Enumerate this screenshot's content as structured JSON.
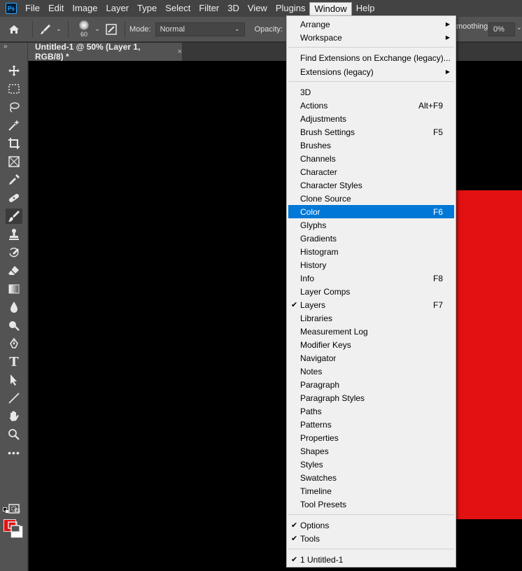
{
  "app": {
    "logo_text": "Ps"
  },
  "menubar": {
    "items": [
      "File",
      "Edit",
      "Image",
      "Layer",
      "Type",
      "Select",
      "Filter",
      "3D",
      "View",
      "Plugins",
      "Window",
      "Help"
    ],
    "active": "Window"
  },
  "options": {
    "brush_size": "60",
    "mode_label": "Mode:",
    "mode_value": "Normal",
    "opacity_label": "Opacity:",
    "smoothing_label": "moothing:",
    "smoothing_value": "0%"
  },
  "document_tab": {
    "title": "Untitled-1 @ 50% (Layer 1, RGB/8) *",
    "close": "×"
  },
  "toolbar": {
    "collapse": "»",
    "tools": [
      "move-tool",
      "marquee-tool",
      "lasso-tool",
      "magic-wand-tool",
      "crop-tool",
      "frame-tool",
      "eyedropper-tool",
      "healing-brush-tool",
      "brush-tool",
      "clone-stamp-tool",
      "history-brush-tool",
      "eraser-tool",
      "gradient-tool",
      "blur-tool",
      "dodge-tool",
      "pen-tool",
      "type-tool",
      "path-selection-tool",
      "line-tool",
      "hand-tool",
      "zoom-tool",
      "more-tools"
    ],
    "active_tool": "brush-tool",
    "foreground": "#e31111",
    "background": "#ffffff"
  },
  "window_menu": {
    "arrange": "Arrange",
    "workspace": "Workspace",
    "find_extensions": "Find Extensions on Exchange (legacy)...",
    "extensions": "Extensions (legacy)",
    "panels": [
      {
        "label": "3D",
        "shortcut": "",
        "checked": false
      },
      {
        "label": "Actions",
        "shortcut": "Alt+F9",
        "checked": false
      },
      {
        "label": "Adjustments",
        "shortcut": "",
        "checked": false
      },
      {
        "label": "Brush Settings",
        "shortcut": "F5",
        "checked": false
      },
      {
        "label": "Brushes",
        "shortcut": "",
        "checked": false
      },
      {
        "label": "Channels",
        "shortcut": "",
        "checked": false
      },
      {
        "label": "Character",
        "shortcut": "",
        "checked": false
      },
      {
        "label": "Character Styles",
        "shortcut": "",
        "checked": false
      },
      {
        "label": "Clone Source",
        "shortcut": "",
        "checked": false
      },
      {
        "label": "Color",
        "shortcut": "F6",
        "checked": false
      },
      {
        "label": "Glyphs",
        "shortcut": "",
        "checked": false
      },
      {
        "label": "Gradients",
        "shortcut": "",
        "checked": false
      },
      {
        "label": "Histogram",
        "shortcut": "",
        "checked": false
      },
      {
        "label": "History",
        "shortcut": "",
        "checked": false
      },
      {
        "label": "Info",
        "shortcut": "F8",
        "checked": false
      },
      {
        "label": "Layer Comps",
        "shortcut": "",
        "checked": false
      },
      {
        "label": "Layers",
        "shortcut": "F7",
        "checked": true
      },
      {
        "label": "Libraries",
        "shortcut": "",
        "checked": false
      },
      {
        "label": "Measurement Log",
        "shortcut": "",
        "checked": false
      },
      {
        "label": "Modifier Keys",
        "shortcut": "",
        "checked": false
      },
      {
        "label": "Navigator",
        "shortcut": "",
        "checked": false
      },
      {
        "label": "Notes",
        "shortcut": "",
        "checked": false
      },
      {
        "label": "Paragraph",
        "shortcut": "",
        "checked": false
      },
      {
        "label": "Paragraph Styles",
        "shortcut": "",
        "checked": false
      },
      {
        "label": "Paths",
        "shortcut": "",
        "checked": false
      },
      {
        "label": "Patterns",
        "shortcut": "",
        "checked": false
      },
      {
        "label": "Properties",
        "shortcut": "",
        "checked": false
      },
      {
        "label": "Shapes",
        "shortcut": "",
        "checked": false
      },
      {
        "label": "Styles",
        "shortcut": "",
        "checked": false
      },
      {
        "label": "Swatches",
        "shortcut": "",
        "checked": false
      },
      {
        "label": "Timeline",
        "shortcut": "",
        "checked": false
      },
      {
        "label": "Tool Presets",
        "shortcut": "",
        "checked": false
      }
    ],
    "highlighted": "Color",
    "options": {
      "label": "Options",
      "checked": true
    },
    "tools": {
      "label": "Tools",
      "checked": true
    },
    "document": {
      "label": "1 Untitled-1",
      "checked": true
    },
    "check_glyph": "✔",
    "submenu_arrow": "▶"
  }
}
